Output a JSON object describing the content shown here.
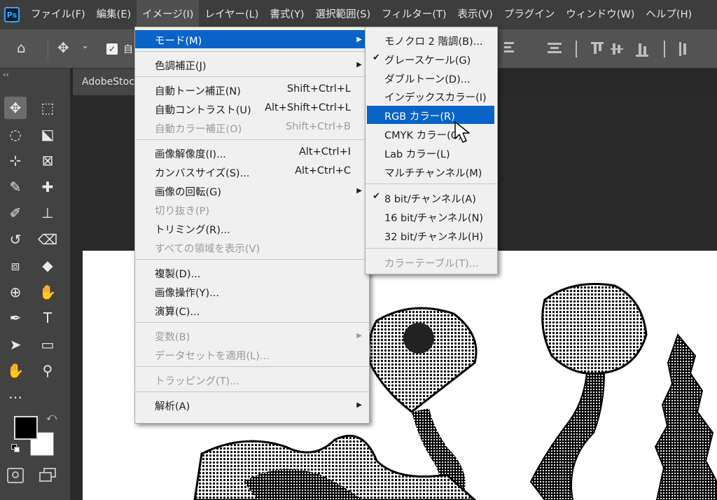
{
  "app": {
    "logo_text": "Ps",
    "menubar": [
      "ファイル(F)",
      "編集(E)",
      "イメージ(I)",
      "レイヤー(L)",
      "書式(Y)",
      "選択範囲(S)",
      "フィルター(T)",
      "表示(V)",
      "プラグイン",
      "ウィンドウ(W)",
      "ヘルプ(H)"
    ],
    "active_menu_index": 2
  },
  "options_bar": {
    "checkbox_label": "自"
  },
  "document": {
    "tab_title": "AdobeStock"
  },
  "panel": {
    "collapse_glyph": "‹‹"
  },
  "image_menu": {
    "items": [
      {
        "label": "モード(M)",
        "shortcut": "",
        "submenu": true,
        "disabled": false,
        "highlighted": true
      },
      {
        "sep": true
      },
      {
        "label": "色調補正(J)",
        "shortcut": "",
        "submenu": true,
        "disabled": false
      },
      {
        "sep": true
      },
      {
        "label": "自動トーン補正(N)",
        "shortcut": "Shift+Ctrl+L",
        "submenu": false,
        "disabled": false
      },
      {
        "label": "自動コントラスト(U)",
        "shortcut": "Alt+Shift+Ctrl+L",
        "submenu": false,
        "disabled": false
      },
      {
        "label": "自動カラー補正(O)",
        "shortcut": "Shift+Ctrl+B",
        "submenu": false,
        "disabled": true
      },
      {
        "sep": true
      },
      {
        "label": "画像解像度(I)...",
        "shortcut": "Alt+Ctrl+I",
        "submenu": false,
        "disabled": false
      },
      {
        "label": "カンバスサイズ(S)...",
        "shortcut": "Alt+Ctrl+C",
        "submenu": false,
        "disabled": false
      },
      {
        "label": "画像の回転(G)",
        "shortcut": "",
        "submenu": true,
        "disabled": false
      },
      {
        "label": "切り抜き(P)",
        "shortcut": "",
        "submenu": false,
        "disabled": true
      },
      {
        "label": "トリミング(R)...",
        "shortcut": "",
        "submenu": false,
        "disabled": false
      },
      {
        "label": "すべての領域を表示(V)",
        "shortcut": "",
        "submenu": false,
        "disabled": true
      },
      {
        "sep": true
      },
      {
        "label": "複製(D)...",
        "shortcut": "",
        "submenu": false,
        "disabled": false
      },
      {
        "label": "画像操作(Y)...",
        "shortcut": "",
        "submenu": false,
        "disabled": false
      },
      {
        "label": "演算(C)...",
        "shortcut": "",
        "submenu": false,
        "disabled": false
      },
      {
        "sep": true
      },
      {
        "label": "変数(B)",
        "shortcut": "",
        "submenu": true,
        "disabled": true
      },
      {
        "label": "データセットを適用(L)...",
        "shortcut": "",
        "submenu": false,
        "disabled": true
      },
      {
        "sep": true
      },
      {
        "label": "トラッピング(T)...",
        "shortcut": "",
        "submenu": false,
        "disabled": true
      },
      {
        "sep": true
      },
      {
        "label": "解析(A)",
        "shortcut": "",
        "submenu": true,
        "disabled": false
      }
    ]
  },
  "mode_submenu": {
    "items": [
      {
        "label": "モノクロ 2 階調(B)...",
        "checked": false,
        "disabled": false
      },
      {
        "label": "グレースケール(G)",
        "checked": true,
        "disabled": false
      },
      {
        "label": "ダブルトーン(D)...",
        "checked": false,
        "disabled": false
      },
      {
        "label": "インデックスカラー(I)",
        "checked": false,
        "disabled": false
      },
      {
        "label": "RGB カラー(R)",
        "checked": false,
        "disabled": false,
        "highlighted": true
      },
      {
        "label": "CMYK カラー(C)",
        "checked": false,
        "disabled": false
      },
      {
        "label": "Lab カラー(L)",
        "checked": false,
        "disabled": false
      },
      {
        "label": "マルチチャンネル(M)",
        "checked": false,
        "disabled": false
      },
      {
        "sep": true
      },
      {
        "label": "8 bit/チャンネル(A)",
        "checked": true,
        "disabled": false
      },
      {
        "label": "16 bit/チャンネル(N)",
        "checked": false,
        "disabled": false
      },
      {
        "label": "32 bit/チャンネル(H)",
        "checked": false,
        "disabled": false
      },
      {
        "sep": true
      },
      {
        "label": "カラーテーブル(T)...",
        "checked": false,
        "disabled": true
      }
    ]
  },
  "colors": {
    "menu_highlight": "#0a64c8",
    "menubar_bg": "#3d3d3d",
    "options_bg": "#535353"
  },
  "tools": [
    "move-tool",
    "marquee-tool",
    "lasso-tool",
    "object-select-tool",
    "crop-tool",
    "frame-tool",
    "eyedropper-tool",
    "healing-brush-tool",
    "brush-tool",
    "stamp-tool",
    "history-brush-tool",
    "eraser-tool",
    "paint-bucket-tool",
    "blur-tool",
    "dodge-tool",
    "smudge-tool",
    "pen-tool",
    "type-tool",
    "path-select-tool",
    "rectangle-tool",
    "hand-tool",
    "zoom-tool",
    "more-tools"
  ]
}
